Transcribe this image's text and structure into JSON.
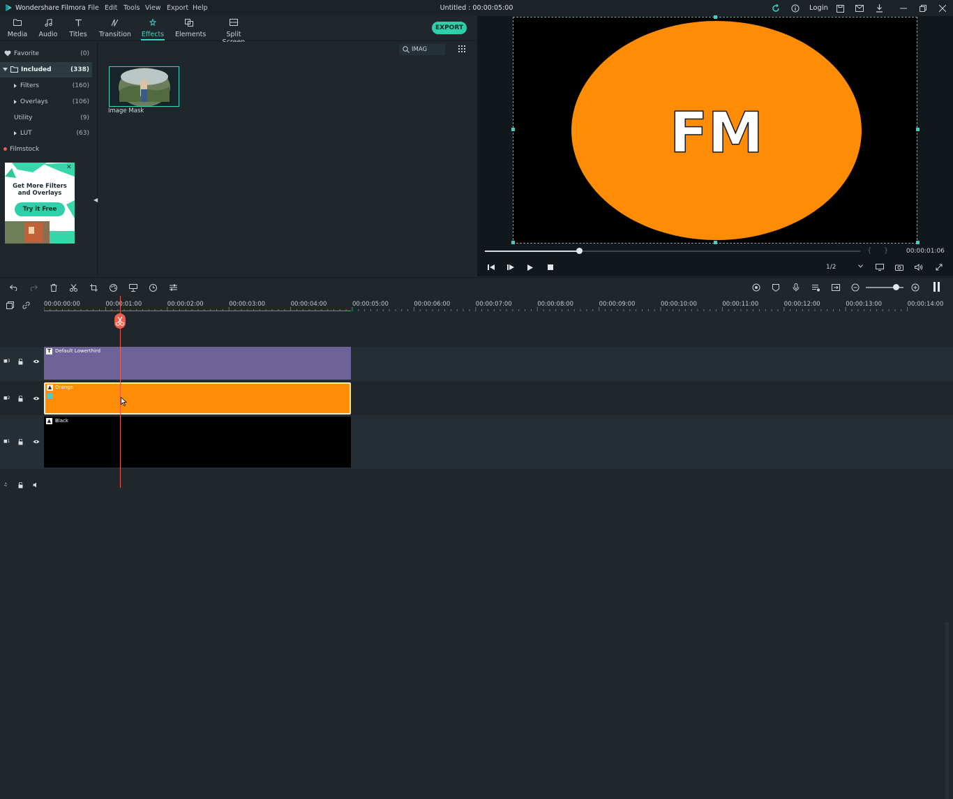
{
  "titlebar": {
    "app_name": "Wondershare Filmora",
    "menu": [
      "File",
      "Edit",
      "Tools",
      "View",
      "Export",
      "Help"
    ],
    "project_title": "Untitled : 00:00:05:00",
    "login_label": "Login"
  },
  "toolbar": {
    "tabs": [
      {
        "label": "Media",
        "icon": "folder-icon"
      },
      {
        "label": "Audio",
        "icon": "music-note-icon"
      },
      {
        "label": "Titles",
        "icon": "text-t-icon"
      },
      {
        "label": "Transition",
        "icon": "transition-icon"
      },
      {
        "label": "Effects",
        "icon": "effects-icon",
        "active": true
      },
      {
        "label": "Elements",
        "icon": "elements-icon"
      },
      {
        "label": "Split Screen",
        "icon": "split-screen-icon"
      }
    ],
    "export_label": "EXPORT"
  },
  "categories": [
    {
      "name": "Favorite",
      "count": "(0)",
      "icon": "heart-icon"
    },
    {
      "name": "Included",
      "count": "(338)",
      "icon": "folder-icon",
      "selected": true
    },
    {
      "name": "Filters",
      "count": "(160)"
    },
    {
      "name": "Overlays",
      "count": "(106)"
    },
    {
      "name": "Utility",
      "count": "(9)"
    },
    {
      "name": "LUT",
      "count": "(63)"
    },
    {
      "name": "Filmstock",
      "count": "",
      "icon": "red-dot-icon"
    }
  ],
  "ad": {
    "headline_line1": "Get More Filters",
    "headline_line2": "and Overlays",
    "button": "Try it Free"
  },
  "effects": {
    "search_value": "IMAG",
    "items": [
      {
        "label": "Image Mask"
      }
    ]
  },
  "preview": {
    "overlay_text": "FM",
    "timecode": "00:00:01:06",
    "quality": "1/2",
    "progress": 0.25,
    "colors": {
      "shape": "#ff8c05",
      "background": "#000000"
    }
  },
  "ruler": {
    "labels": [
      "00:00:00:00",
      "00:00:01:00",
      "00:00:02:00",
      "00:00:03:00",
      "00:00:04:00",
      "00:00:05:00",
      "00:00:06:00",
      "00:00:07:00",
      "00:00:08:00",
      "00:00:09:00",
      "00:00:10:00",
      "00:00:11:00",
      "00:00:12:00",
      "00:00:13:00",
      "00:00:14:00"
    ]
  },
  "tracks": [
    {
      "id": "3",
      "clip": "Default Lowerthird",
      "color": "#6e6398",
      "type": "title"
    },
    {
      "id": "2",
      "clip": "Orange",
      "color": "#ff8c05",
      "type": "image"
    },
    {
      "id": "1",
      "clip": "Black",
      "color": "#000000",
      "type": "image"
    }
  ]
}
